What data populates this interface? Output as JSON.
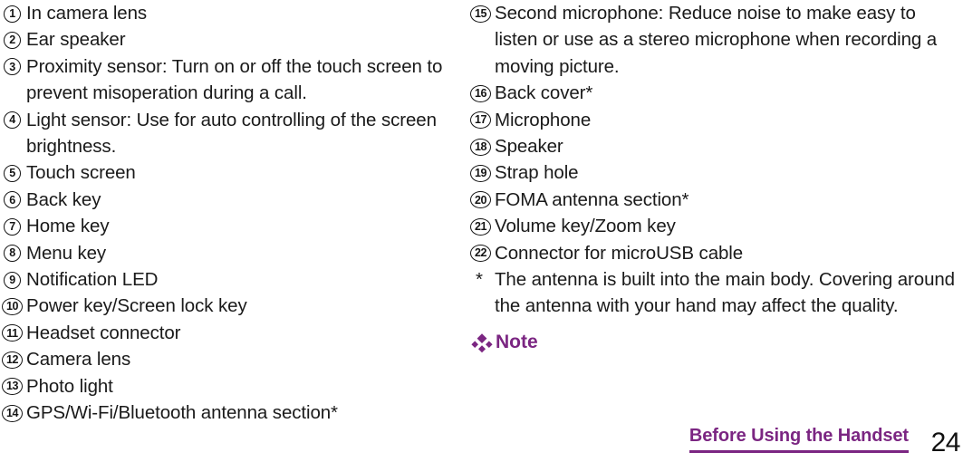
{
  "document": {
    "type": "manual-page",
    "colors": {
      "accent_purple": "#7B2682",
      "body_text": "#1a1a1a"
    }
  },
  "left_column": {
    "items": [
      {
        "number": "1",
        "label": "In camera lens"
      },
      {
        "number": "2",
        "label": "Ear speaker"
      },
      {
        "number": "3",
        "label": "Proximity sensor: Turn on or off the touch screen to prevent misoperation during a call."
      },
      {
        "number": "4",
        "label": "Light sensor: Use for auto controlling of the screen brightness."
      },
      {
        "number": "5",
        "label": "Touch screen"
      },
      {
        "number": "6",
        "label": "Back key"
      },
      {
        "number": "7",
        "label": "Home key"
      },
      {
        "number": "8",
        "label": "Menu key"
      },
      {
        "number": "9",
        "label": "Notification LED"
      },
      {
        "number": "10",
        "label": "Power key/Screen lock key"
      },
      {
        "number": "11",
        "label": "Headset connector"
      },
      {
        "number": "12",
        "label": "Camera lens"
      },
      {
        "number": "13",
        "label": "Photo light"
      },
      {
        "number": "14",
        "label": "GPS/Wi-Fi/Bluetooth antenna section*"
      }
    ]
  },
  "right_column": {
    "items": [
      {
        "number": "15",
        "label": "Second microphone: Reduce noise to make easy to listen or use as a stereo microphone when recording a moving picture."
      },
      {
        "number": "16",
        "label": "Back cover*"
      },
      {
        "number": "17",
        "label": "Microphone"
      },
      {
        "number": "18",
        "label": "Speaker"
      },
      {
        "number": "19",
        "label": "Strap hole"
      },
      {
        "number": "20",
        "label": "FOMA antenna section*"
      },
      {
        "number": "21",
        "label": "Volume key/Zoom key"
      },
      {
        "number": "22",
        "label": "Connector for microUSB cable"
      }
    ],
    "footnote": {
      "mark": "*",
      "text": "The antenna is built into the main body. Covering around the antenna with your hand may affect the quality."
    },
    "note_heading": {
      "icon": "diamond-cluster-icon",
      "label": "Note"
    }
  },
  "footer": {
    "section_title": "Before Using the Handset",
    "page_number": "24"
  }
}
